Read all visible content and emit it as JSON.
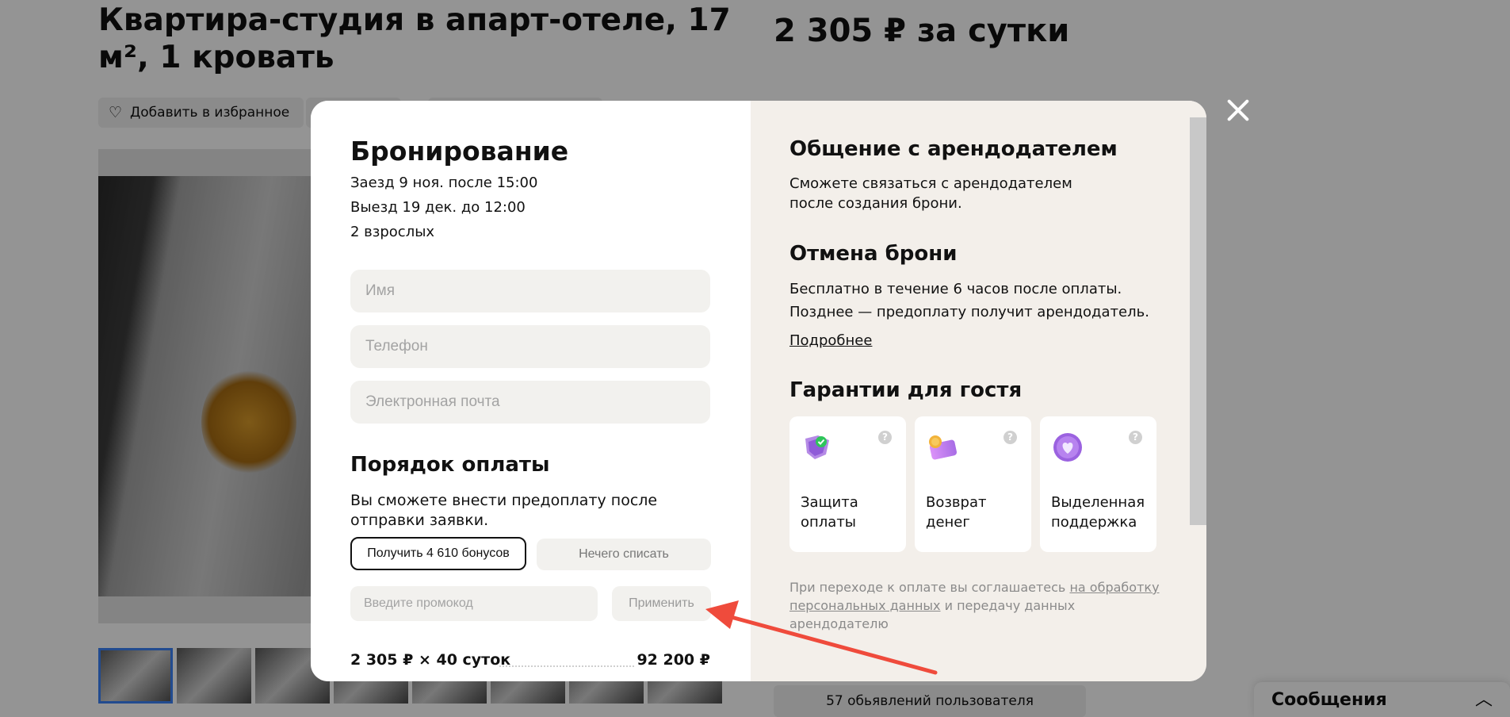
{
  "listing": {
    "title": "Квартира-студия в апарт-отеле, 17 м², 1 кровать",
    "price": "2 305 ₽ за сутки",
    "favorite_label": "Добавить в избранное",
    "user_ads_label": "57 обьявлений пользователя"
  },
  "messages_widget": {
    "label": "Сообщения"
  },
  "booking": {
    "title": "Бронирование",
    "checkin": "Заезд 9 ноя. после 15:00",
    "checkout": "Выезд 19 дек. до 12:00",
    "guests": "2 взрослых",
    "fields": {
      "name_placeholder": "Имя",
      "phone_placeholder": "Телефон",
      "email_placeholder": "Электронная почта"
    },
    "payment": {
      "title": "Порядок оплаты",
      "text": "Вы сможете внести предоплату после отправки заявки.",
      "bonus_button": "Получить 4 610 бонусов",
      "nothing_button": "Нечего списать",
      "promo_placeholder": "Введите промокод",
      "apply_button": "Применить"
    },
    "summary": {
      "left": "2 305 ₽ × 40 суток",
      "right": "92 200 ₽"
    }
  },
  "host_info": {
    "contact_title": "Общение с арендодателем",
    "contact_text_1": "Сможете связаться с арендодателем",
    "contact_text_2": "после создания брони.",
    "cancel_title": "Отмена брони",
    "cancel_text_1": "Бесплатно в течение 6 часов после оплаты.",
    "cancel_text_2": "Позднее — предоплату получит арендодатель.",
    "more_link": "Подробнее",
    "guarantees_title": "Гарантии для гостя",
    "guarantees": [
      {
        "label_1": "Защита",
        "label_2": "оплаты",
        "icon": "shield-check-icon"
      },
      {
        "label_1": "Возврат",
        "label_2": "денег",
        "icon": "card-coin-icon"
      },
      {
        "label_1": "Выделенная",
        "label_2": "поддержка",
        "icon": "heart-icon"
      }
    ],
    "consent_prefix": "При переходе к оплате вы соглашаетесь ",
    "consent_link_1": "на обработку",
    "consent_link_2": "персональных данных",
    "consent_suffix": " и передачу данных арендодателю"
  },
  "colors": {
    "right_panel": "#f3efea",
    "field_bg": "#f2f1ee",
    "arrow": "#ef4b3c",
    "thumb_active": "#3b82f6"
  }
}
